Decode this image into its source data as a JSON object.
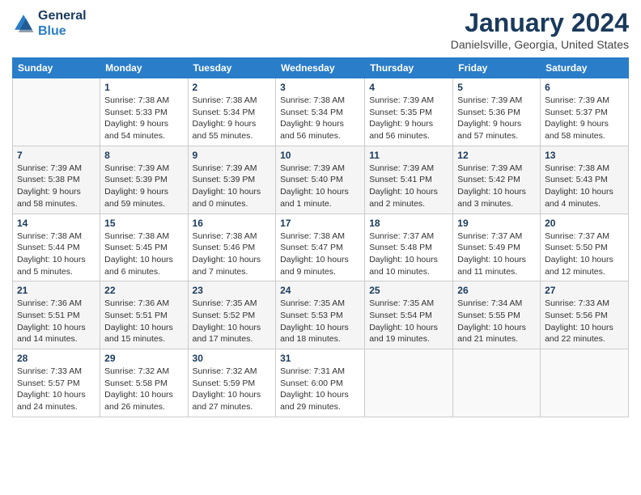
{
  "header": {
    "logo": {
      "line1": "General",
      "line2": "Blue"
    },
    "title": "January 2024",
    "location": "Danielsville, Georgia, United States"
  },
  "days_of_week": [
    "Sunday",
    "Monday",
    "Tuesday",
    "Wednesday",
    "Thursday",
    "Friday",
    "Saturday"
  ],
  "weeks": [
    [
      {
        "day": "",
        "info": ""
      },
      {
        "day": "1",
        "info": "Sunrise: 7:38 AM\nSunset: 5:33 PM\nDaylight: 9 hours\nand 54 minutes."
      },
      {
        "day": "2",
        "info": "Sunrise: 7:38 AM\nSunset: 5:34 PM\nDaylight: 9 hours\nand 55 minutes."
      },
      {
        "day": "3",
        "info": "Sunrise: 7:38 AM\nSunset: 5:34 PM\nDaylight: 9 hours\nand 56 minutes."
      },
      {
        "day": "4",
        "info": "Sunrise: 7:39 AM\nSunset: 5:35 PM\nDaylight: 9 hours\nand 56 minutes."
      },
      {
        "day": "5",
        "info": "Sunrise: 7:39 AM\nSunset: 5:36 PM\nDaylight: 9 hours\nand 57 minutes."
      },
      {
        "day": "6",
        "info": "Sunrise: 7:39 AM\nSunset: 5:37 PM\nDaylight: 9 hours\nand 58 minutes."
      }
    ],
    [
      {
        "day": "7",
        "info": "Sunrise: 7:39 AM\nSunset: 5:38 PM\nDaylight: 9 hours\nand 58 minutes."
      },
      {
        "day": "8",
        "info": "Sunrise: 7:39 AM\nSunset: 5:39 PM\nDaylight: 9 hours\nand 59 minutes."
      },
      {
        "day": "9",
        "info": "Sunrise: 7:39 AM\nSunset: 5:39 PM\nDaylight: 10 hours\nand 0 minutes."
      },
      {
        "day": "10",
        "info": "Sunrise: 7:39 AM\nSunset: 5:40 PM\nDaylight: 10 hours\nand 1 minute."
      },
      {
        "day": "11",
        "info": "Sunrise: 7:39 AM\nSunset: 5:41 PM\nDaylight: 10 hours\nand 2 minutes."
      },
      {
        "day": "12",
        "info": "Sunrise: 7:39 AM\nSunset: 5:42 PM\nDaylight: 10 hours\nand 3 minutes."
      },
      {
        "day": "13",
        "info": "Sunrise: 7:38 AM\nSunset: 5:43 PM\nDaylight: 10 hours\nand 4 minutes."
      }
    ],
    [
      {
        "day": "14",
        "info": "Sunrise: 7:38 AM\nSunset: 5:44 PM\nDaylight: 10 hours\nand 5 minutes."
      },
      {
        "day": "15",
        "info": "Sunrise: 7:38 AM\nSunset: 5:45 PM\nDaylight: 10 hours\nand 6 minutes."
      },
      {
        "day": "16",
        "info": "Sunrise: 7:38 AM\nSunset: 5:46 PM\nDaylight: 10 hours\nand 7 minutes."
      },
      {
        "day": "17",
        "info": "Sunrise: 7:38 AM\nSunset: 5:47 PM\nDaylight: 10 hours\nand 9 minutes."
      },
      {
        "day": "18",
        "info": "Sunrise: 7:37 AM\nSunset: 5:48 PM\nDaylight: 10 hours\nand 10 minutes."
      },
      {
        "day": "19",
        "info": "Sunrise: 7:37 AM\nSunset: 5:49 PM\nDaylight: 10 hours\nand 11 minutes."
      },
      {
        "day": "20",
        "info": "Sunrise: 7:37 AM\nSunset: 5:50 PM\nDaylight: 10 hours\nand 12 minutes."
      }
    ],
    [
      {
        "day": "21",
        "info": "Sunrise: 7:36 AM\nSunset: 5:51 PM\nDaylight: 10 hours\nand 14 minutes."
      },
      {
        "day": "22",
        "info": "Sunrise: 7:36 AM\nSunset: 5:51 PM\nDaylight: 10 hours\nand 15 minutes."
      },
      {
        "day": "23",
        "info": "Sunrise: 7:35 AM\nSunset: 5:52 PM\nDaylight: 10 hours\nand 17 minutes."
      },
      {
        "day": "24",
        "info": "Sunrise: 7:35 AM\nSunset: 5:53 PM\nDaylight: 10 hours\nand 18 minutes."
      },
      {
        "day": "25",
        "info": "Sunrise: 7:35 AM\nSunset: 5:54 PM\nDaylight: 10 hours\nand 19 minutes."
      },
      {
        "day": "26",
        "info": "Sunrise: 7:34 AM\nSunset: 5:55 PM\nDaylight: 10 hours\nand 21 minutes."
      },
      {
        "day": "27",
        "info": "Sunrise: 7:33 AM\nSunset: 5:56 PM\nDaylight: 10 hours\nand 22 minutes."
      }
    ],
    [
      {
        "day": "28",
        "info": "Sunrise: 7:33 AM\nSunset: 5:57 PM\nDaylight: 10 hours\nand 24 minutes."
      },
      {
        "day": "29",
        "info": "Sunrise: 7:32 AM\nSunset: 5:58 PM\nDaylight: 10 hours\nand 26 minutes."
      },
      {
        "day": "30",
        "info": "Sunrise: 7:32 AM\nSunset: 5:59 PM\nDaylight: 10 hours\nand 27 minutes."
      },
      {
        "day": "31",
        "info": "Sunrise: 7:31 AM\nSunset: 6:00 PM\nDaylight: 10 hours\nand 29 minutes."
      },
      {
        "day": "",
        "info": ""
      },
      {
        "day": "",
        "info": ""
      },
      {
        "day": "",
        "info": ""
      }
    ]
  ]
}
